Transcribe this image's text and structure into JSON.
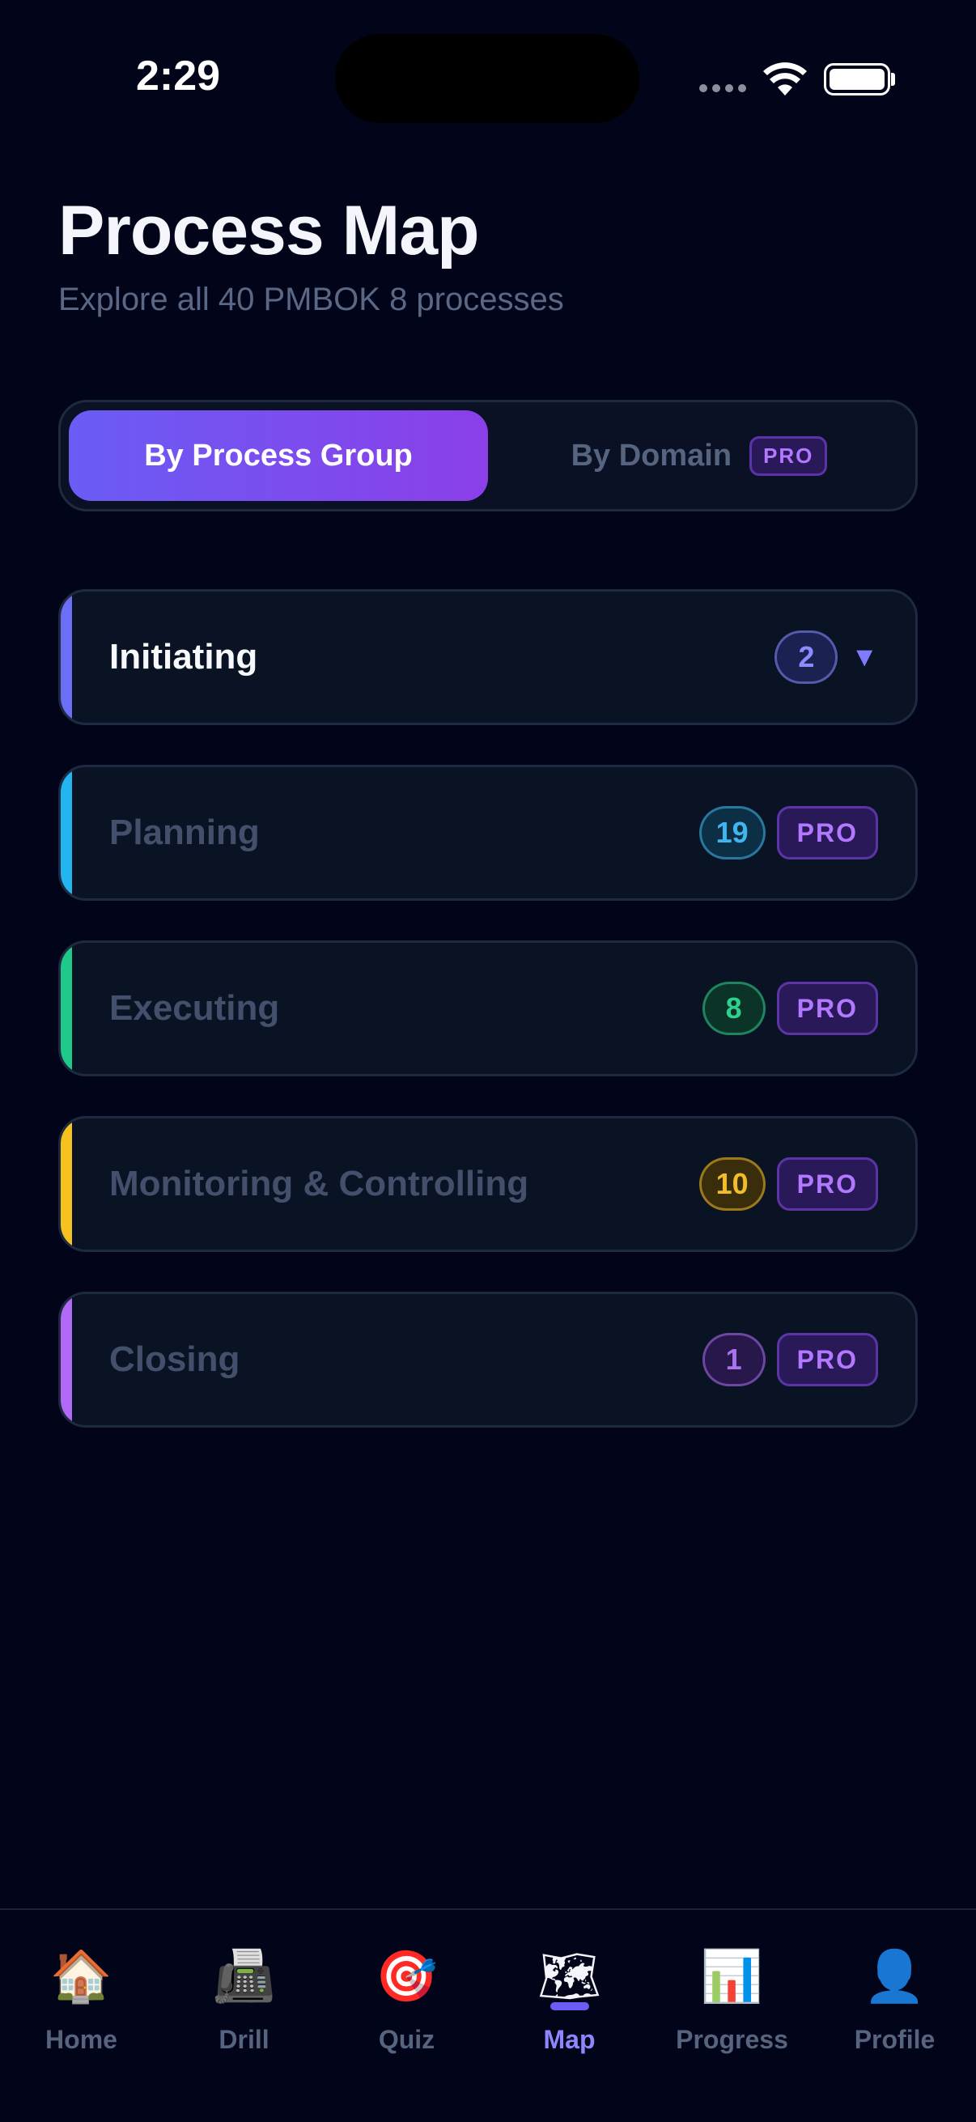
{
  "status_bar": {
    "time": "2:29"
  },
  "header": {
    "title": "Process Map",
    "subtitle": "Explore all 40 PMBOK 8 processes"
  },
  "segmented": {
    "active_label": "By Process Group",
    "inactive_label": "By Domain",
    "inactive_badge": "PRO"
  },
  "groups": [
    {
      "name": "Initiating",
      "count": "2",
      "accent": "#6c6ef5",
      "badge_color": "#8b8cff",
      "badge_bg": "#1b2150",
      "locked": false,
      "badge": ""
    },
    {
      "name": "Planning",
      "count": "19",
      "accent": "#22b5f0",
      "badge_color": "#3fb6ee",
      "badge_bg": "#0c2f45",
      "locked": true,
      "badge": "PRO"
    },
    {
      "name": "Executing",
      "count": "8",
      "accent": "#1fc98a",
      "badge_color": "#2fcf8f",
      "badge_bg": "#0b3328",
      "locked": true,
      "badge": "PRO"
    },
    {
      "name": "Monitoring & Controlling",
      "count": "10",
      "accent": "#f5c220",
      "badge_color": "#f1bd29",
      "badge_bg": "#3a2d0c",
      "locked": true,
      "badge": "PRO"
    },
    {
      "name": "Closing",
      "count": "1",
      "accent": "#b26af6",
      "badge_color": "#a873ec",
      "badge_bg": "#27174a",
      "locked": true,
      "badge": "PRO"
    }
  ],
  "tabs": [
    {
      "label": "Home",
      "icon": "🏠",
      "icon_name": "house-icon",
      "active": false
    },
    {
      "label": "Drill",
      "icon": "📠",
      "icon_name": "fax-machine-icon",
      "active": false
    },
    {
      "label": "Quiz",
      "icon": "🎯",
      "icon_name": "target-icon",
      "active": false
    },
    {
      "label": "Map",
      "icon": "🗺",
      "icon_name": "world-map-icon",
      "active": true
    },
    {
      "label": "Progress",
      "icon": "📊",
      "icon_name": "bar-chart-icon",
      "active": false
    },
    {
      "label": "Profile",
      "icon": "👤",
      "icon_name": "user-silhouette-icon",
      "active": false
    }
  ]
}
